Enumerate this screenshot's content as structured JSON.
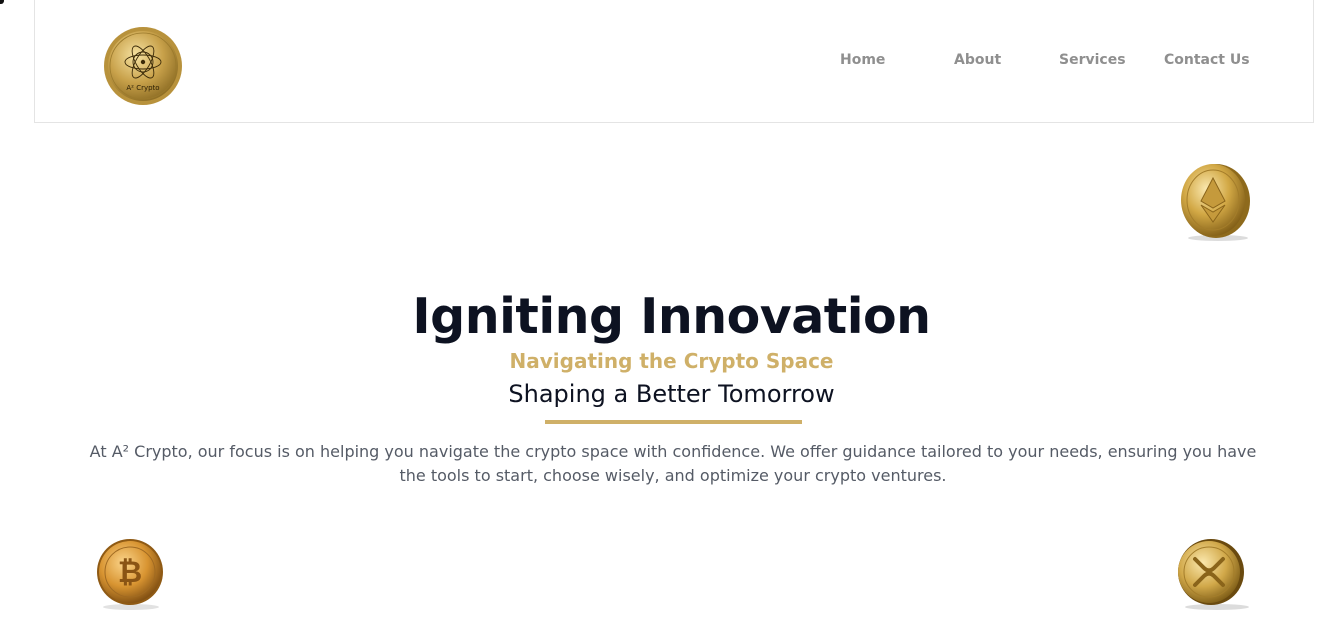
{
  "brand": {
    "logo_text": "A² Crypto",
    "logo_icon": "atom-gold-coin-logo",
    "accent": "#cfb068"
  },
  "nav": {
    "items": [
      {
        "label": "Home"
      },
      {
        "label": "About"
      },
      {
        "label": "Services"
      },
      {
        "label": "Contact Us"
      }
    ],
    "color": "#8f8f8f"
  },
  "hero": {
    "title": "Igniting Innovation",
    "subtitle_gold": "Navigating the Crypto Space",
    "subtitle": "Shaping a Better Tomorrow",
    "body": "At A² Crypto, our focus is on helping you navigate the crypto space with confidence. We offer guidance tailored to your needs, ensuring you have the tools to start, choose wisely, and optimize your crypto ventures.",
    "title_color": "#0d1221",
    "body_color": "#555b66"
  },
  "decor": {
    "coins": [
      "ethereum-coin-icon",
      "bitcoin-coin-icon",
      "xrp-coin-icon"
    ]
  }
}
